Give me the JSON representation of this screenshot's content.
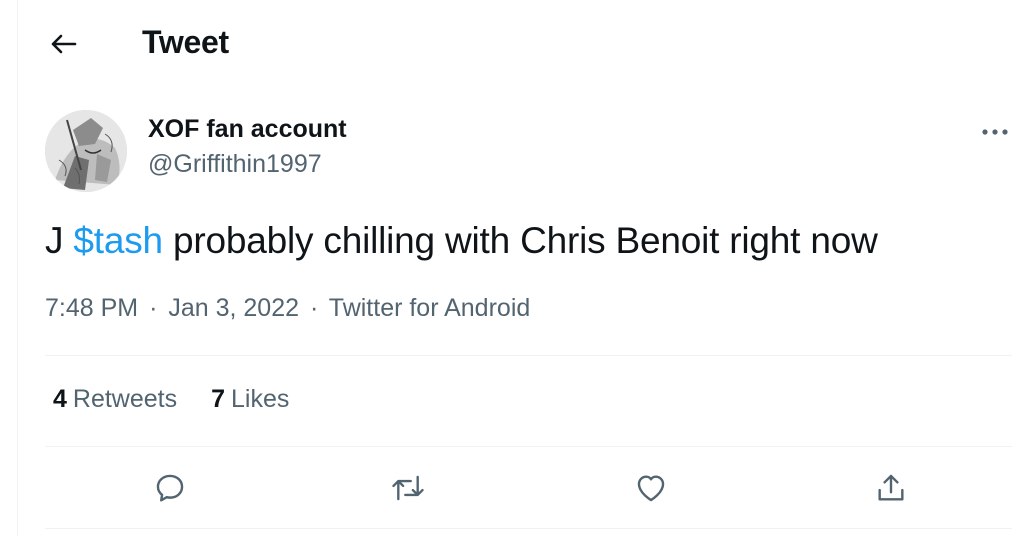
{
  "header": {
    "title": "Tweet",
    "back_icon": "arrow-left-icon"
  },
  "author": {
    "display_name": "XOF fan account",
    "handle": "@Griffithin1997",
    "avatar_icon": "avatar-sketch-image"
  },
  "tweet": {
    "text_before": "J ",
    "cashtag": "$tash",
    "text_after": " probably chilling with Chris Benoit right now",
    "time": "7:48 PM",
    "separator": "·",
    "date": "Jan 3, 2022",
    "source": "Twitter for Android"
  },
  "stats": {
    "retweets_count": "4",
    "retweets_label": "Retweets",
    "likes_count": "7",
    "likes_label": "Likes"
  },
  "actions": {
    "reply_icon": "reply-icon",
    "retweet_icon": "retweet-icon",
    "like_icon": "heart-icon",
    "share_icon": "share-icon",
    "more_icon": "more-icon"
  },
  "colors": {
    "text": "#0f1419",
    "secondary": "#536471",
    "accent": "#1d9bf0",
    "divider": "#eff3f4"
  }
}
